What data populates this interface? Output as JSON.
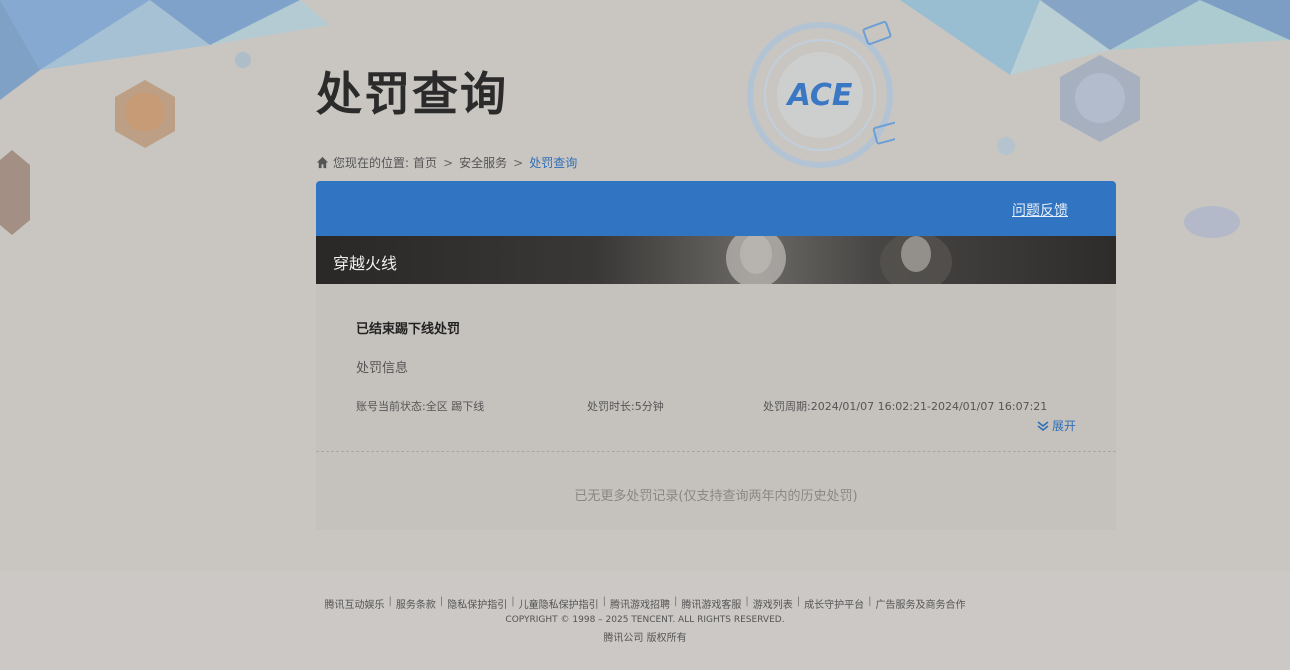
{
  "page": {
    "title": "处罚查询"
  },
  "breadcrumb": {
    "prefix": "您现在的位置:",
    "items": [
      "首页",
      "安全服务"
    ],
    "current": "处罚查询",
    "separator": ">"
  },
  "panel": {
    "feedback_label": "问题反馈",
    "game_name": "穿越火线"
  },
  "record": {
    "title": "已结束踢下线处罚",
    "section_label": "处罚信息",
    "status": "账号当前状态:全区 踢下线",
    "duration": "处罚时长:5分钟",
    "period": "处罚周期:2024/01/07 16:02:21-2024/01/07 16:07:21",
    "expand_label": "展开"
  },
  "no_more_text": "已无更多处罚记录(仅支持查询两年内的历史处罚)",
  "footer": {
    "links": [
      "腾讯互动娱乐",
      "服务条款",
      "隐私保护指引",
      "儿童隐私保护指引",
      "腾讯游戏招聘",
      "腾讯游戏客服",
      "游戏列表",
      "成长守护平台",
      "广告服务及商务合作"
    ],
    "copyright": "COPYRIGHT © 1998 – 2025 TENCENT. ALL RIGHTS RESERVED.",
    "company": "腾讯公司 版权所有"
  },
  "logo_text": "ACE",
  "colors": {
    "accent": "#3175c2",
    "link": "#2f6fb7",
    "background": "#c9c6c2"
  }
}
